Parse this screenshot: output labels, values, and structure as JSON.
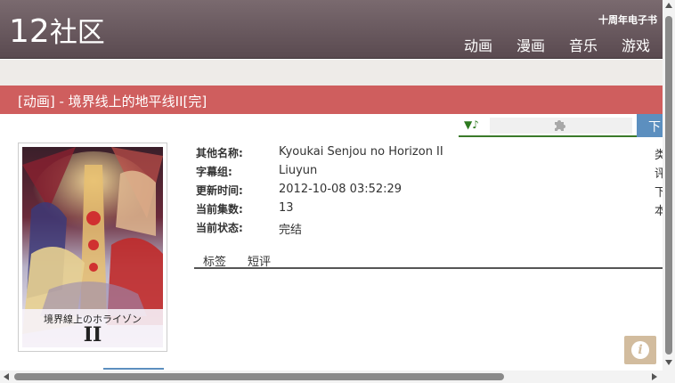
{
  "header": {
    "logo_number": "12",
    "logo_text": "社区",
    "tagline": "十周年电子书",
    "nav": [
      "动画",
      "漫画",
      "音乐",
      "游戏"
    ]
  },
  "title": "[动画] - 境界线上的地平线II[完]",
  "toolbar": {
    "music_icon": "▼♪",
    "download_label": "下"
  },
  "poster": {
    "title_text": "境界線上のホライゾン",
    "numeral": "II"
  },
  "info": {
    "rows": [
      {
        "label": "其他名称:",
        "value": "Kyoukai Senjou no Horizon II",
        "edge": "类"
      },
      {
        "label": "字幕组:",
        "value": "Liuyun",
        "edge": "评"
      },
      {
        "label": "更新时间:",
        "value": "2012-10-08 03:52:29",
        "edge": "下"
      },
      {
        "label": "当前集数:",
        "value": "13",
        "edge": "本"
      },
      {
        "label": "当前状态:",
        "value": "完结",
        "edge": ""
      }
    ]
  },
  "tabs": [
    "标签",
    "短评"
  ],
  "colors": {
    "header": "#5a4a50",
    "titlebar": "#cf5e5e",
    "download": "#5c8fbf",
    "info_button": "#d2bc9e"
  }
}
